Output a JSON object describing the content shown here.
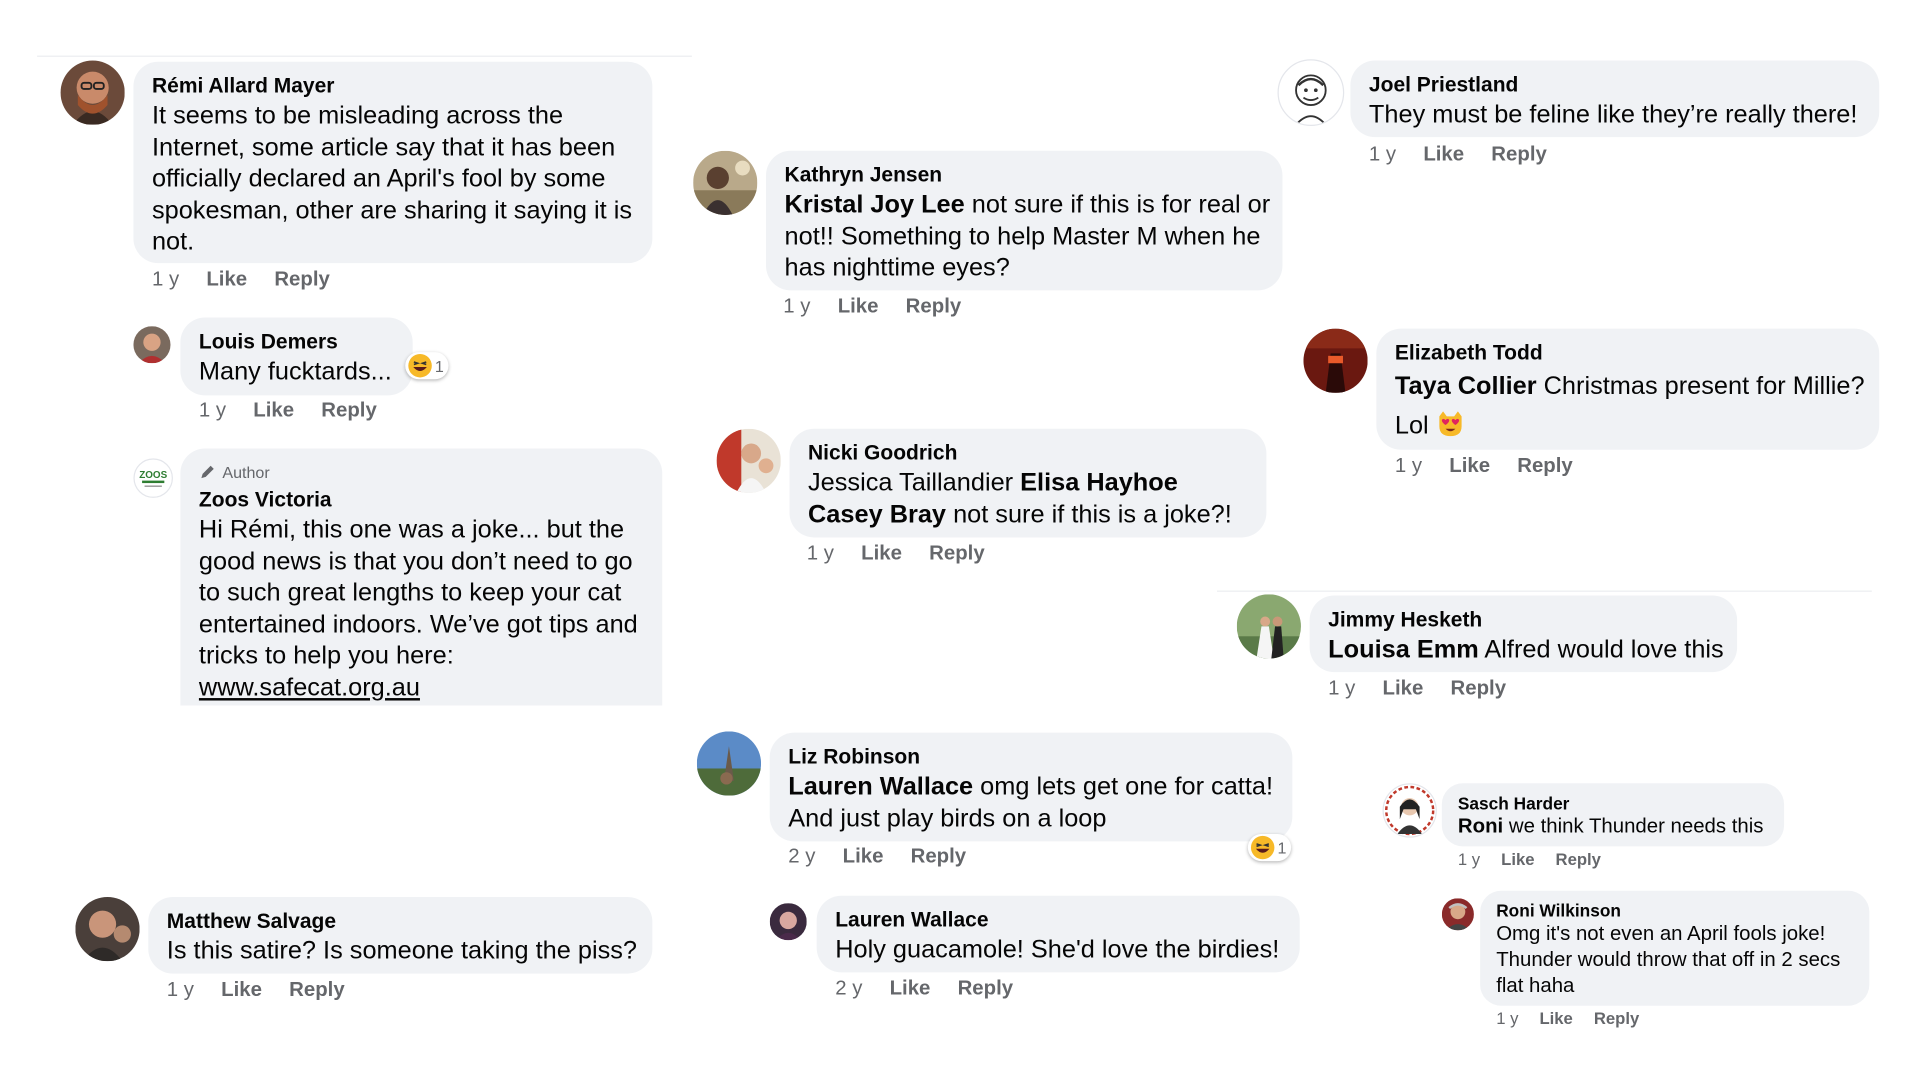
{
  "meta_labels": {
    "like": "Like",
    "reply": "Reply"
  },
  "comments": [
    {
      "name": "Rémi Allard Mayer",
      "segments": [
        {
          "t": "It seems to be misleading across the Internet, some article say that it has been officially declared an April's fool by some spokesman, other are sharing it saying it is not."
        }
      ],
      "time": "1 y"
    },
    {
      "name": "Louis Demers",
      "segments": [
        {
          "t": "Many fucktards..."
        }
      ],
      "time": "1 y",
      "reaction": {
        "emoji": "laugh",
        "count": "1"
      }
    },
    {
      "name": "Zoos Victoria",
      "badge": "Author",
      "segments": [
        {
          "t": "Hi Rémi, this one was a joke... but the good news is that you don’t need to go to such great lengths to keep your cat entertained indoors. We’ve got tips and tricks to help you here: "
        }
      ],
      "link": "www.safecat.org.au"
    },
    {
      "name": "Matthew Salvage",
      "segments": [
        {
          "t": "Is this satire? Is someone taking the piss?"
        }
      ],
      "time": "1 y"
    },
    {
      "name": "Kathryn Jensen",
      "segments": [
        {
          "b": "Kristal Joy Lee"
        },
        {
          "t": " not sure if this is for real or not!! Something to help Master M when he has nighttime eyes?"
        }
      ],
      "time": "1 y"
    },
    {
      "name": "Nicki Goodrich",
      "segments": [
        {
          "t": "Jessica Taillandier "
        },
        {
          "b": "Elisa Hayhoe Casey Bray"
        },
        {
          "t": " not sure if this is a joke?!"
        }
      ],
      "time": "1 y"
    },
    {
      "name": "Liz Robinson",
      "segments": [
        {
          "b": "Lauren Wallace"
        },
        {
          "t": " omg lets get one for catta! And just play birds on a loop"
        }
      ],
      "time": "2 y",
      "reaction": {
        "emoji": "laugh",
        "count": "1"
      }
    },
    {
      "name": "Lauren Wallace",
      "segments": [
        {
          "t": "Holy guacamole! She'd love the birdies!"
        }
      ],
      "time": "2 y"
    },
    {
      "name": "Joel Priestland",
      "segments": [
        {
          "t": "They must be feline like they’re really there!"
        }
      ],
      "time": "1 y"
    },
    {
      "name": "Elizabeth Todd",
      "segments": [
        {
          "b": "Taya Collier"
        },
        {
          "t": " Christmas present for Millie? Lol "
        }
      ],
      "inline_emoji": "heart-eyes-cat",
      "time": "1 y"
    },
    {
      "name": "Jimmy Hesketh",
      "segments": [
        {
          "b": "Louisa Emm"
        },
        {
          "t": " Alfred would love this"
        }
      ],
      "time": "1 y"
    },
    {
      "name": "Sasch Harder",
      "segments": [
        {
          "b": "Roni"
        },
        {
          "t": " we think Thunder needs this"
        }
      ],
      "time": "1 y"
    },
    {
      "name": "Roni Wilkinson",
      "segments": [
        {
          "t": "Omg it's not even an April fools joke! Thunder would throw that off in 2 secs flat haha"
        }
      ],
      "time": "1 y"
    }
  ],
  "colors": {
    "bubble": "#f0f2f5",
    "secondary_text": "#65676b",
    "primary_text": "#050505"
  }
}
